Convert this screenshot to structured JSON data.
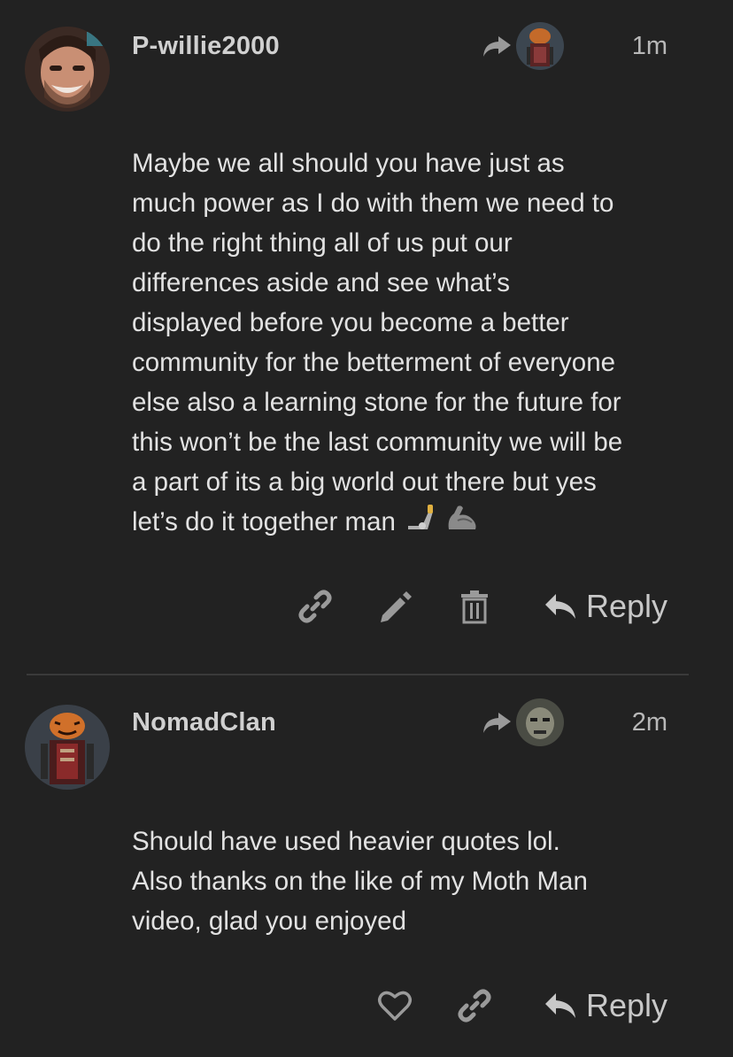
{
  "posts": [
    {
      "username": "P-willie2000",
      "time": "1m",
      "body": "Maybe we all should you have just as\nmuch power as I do with them we need to\ndo the right thing all of us put our\ndifferences aside and see what’s\ndisplayed before you become a better\ncommunity for the betterment of everyone\nelse also a learning stone for the future for\nthis won’t be the last community we will be\na part of its a big world out there but yes\nlet’s do it together man",
      "emojis": [
        "mechanical-arm-emoji",
        "flexed-biceps-emoji"
      ],
      "actions": [
        "link-icon",
        "edit-icon",
        "trash-icon"
      ],
      "reply_label": "Reply"
    },
    {
      "username": "NomadClan",
      "time": "2m",
      "body": "Should have used heavier quotes lol.\nAlso thanks on the like of my Moth Man\nvideo, glad you enjoyed",
      "actions": [
        "heart-icon",
        "link-icon"
      ],
      "reply_label": "Reply"
    }
  ],
  "colors": {
    "background": "#222222",
    "text": "#e2e2e2",
    "muted": "#b8b8b8",
    "icon": "#9a9a9a",
    "divider": "#3a3a3a"
  }
}
